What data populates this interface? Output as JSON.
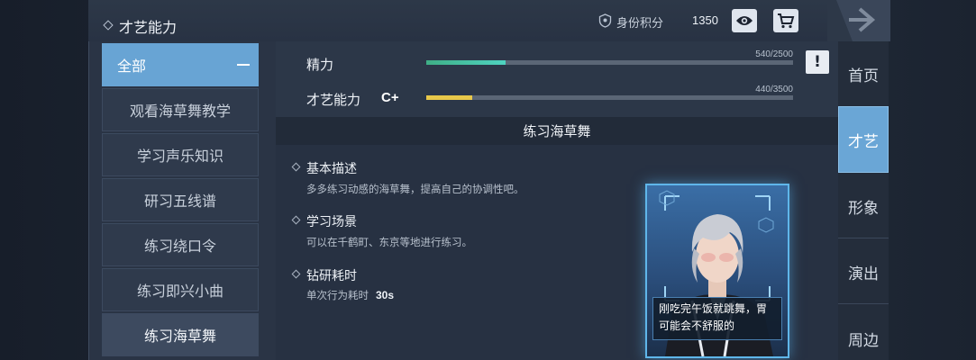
{
  "header": {
    "title": "才艺能力",
    "score_label": "身份积分",
    "score_value": "1350",
    "icons": [
      "shield-icon",
      "eye-icon",
      "cart-icon",
      "arrow-right-icon"
    ]
  },
  "categories": {
    "all_label": "全部",
    "items": [
      {
        "label": "观看海草舞教学"
      },
      {
        "label": "学习声乐知识"
      },
      {
        "label": "研习五线谱"
      },
      {
        "label": "练习绕口令"
      },
      {
        "label": "练习即兴小曲"
      },
      {
        "label": "练习海草舞"
      }
    ]
  },
  "stats": {
    "energy": {
      "label": "精力",
      "value_text": "540/2500",
      "fraction": 0.216
    },
    "talent": {
      "label": "才艺能力",
      "grade": "C+",
      "value_text": "440/3500",
      "fraction": 0.126
    },
    "colors": {
      "energy": "#4fd3c0",
      "talent": "#e8c84a"
    }
  },
  "detail": {
    "title": "练习海草舞",
    "sections": [
      {
        "title": "基本描述",
        "text": "多多练习动感的海草舞，提高自己的协调性吧。"
      },
      {
        "title": "学习场景",
        "text": "可以在千鹤町、东京等地进行练习。"
      },
      {
        "title": "钻研耗时",
        "text": "单次行为耗时",
        "value": "30s"
      }
    ],
    "card_quote": "刚吃完午饭就跳舞，胃可能会不舒服的"
  },
  "nav": {
    "items": [
      {
        "label": "首页"
      },
      {
        "label": "才艺"
      },
      {
        "label": "形象"
      },
      {
        "label": "演出"
      },
      {
        "label": "周边"
      }
    ]
  }
}
